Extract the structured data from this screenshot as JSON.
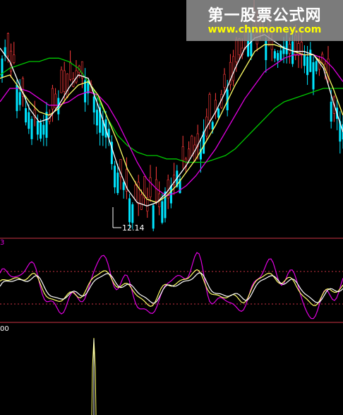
{
  "watermark": {
    "title": "第一股票公式网",
    "url": "www.chnmoney.com"
  },
  "colors": {
    "background": "#000000",
    "up": "#ff3b3b",
    "down": "#00e5ff",
    "ma_white": "#ffffff",
    "ma_yellow": "#ffff66",
    "ma_magenta": "#e000e0",
    "ma_green": "#00c800",
    "panel_line": "#cc3344"
  },
  "main_panel": {
    "low_marker_label": "12.14"
  },
  "indicator_panel": {
    "label": "3"
  },
  "volume_panel": {
    "label": "00"
  },
  "chart_data": {
    "type": "line",
    "series": [
      {
        "values": [
          17.2,
          16.8,
          16.1,
          15.4,
          15.0,
          15.1,
          15.5,
          16.0,
          16.4,
          16.3,
          15.5,
          14.6,
          13.7,
          13.0,
          12.6,
          12.5,
          12.6,
          12.9,
          13.3,
          13.7,
          14.2,
          14.8,
          15.3,
          15.9,
          16.6,
          17.2,
          17.5,
          17.6,
          17.4,
          17.2,
          17.1,
          17.1,
          17.0,
          16.6,
          15.6,
          14.7
        ]
      },
      {
        "values": [
          16.3,
          16.4,
          16.0,
          15.6,
          15.3,
          15.2,
          15.4,
          15.8,
          16.1,
          16.2,
          15.8,
          15.1,
          14.4,
          13.6,
          13.1,
          12.7,
          12.6,
          12.8,
          13.1,
          13.5,
          13.9,
          14.4,
          14.9,
          15.5,
          16.1,
          16.6,
          17.1,
          17.3,
          17.3,
          17.2,
          17.1,
          17.0,
          17.0,
          16.7,
          16.0,
          15.2
        ]
      },
      {
        "values": [
          15.6,
          16.0,
          16.0,
          15.9,
          15.7,
          15.5,
          15.5,
          15.6,
          15.8,
          15.9,
          15.8,
          15.5,
          15.0,
          14.4,
          13.8,
          13.3,
          13.0,
          12.8,
          12.9,
          13.1,
          13.4,
          13.8,
          14.2,
          14.7,
          15.2,
          15.7,
          16.1,
          16.5,
          16.7,
          16.9,
          17.0,
          17.0,
          17.0,
          16.9,
          16.6,
          16.2
        ]
      },
      {
        "values": [
          16.4,
          16.6,
          16.7,
          16.8,
          16.8,
          16.9,
          16.9,
          16.8,
          16.6,
          16.2,
          15.7,
          15.1,
          14.6,
          14.3,
          14.1,
          14.0,
          14.0,
          13.9,
          13.9,
          13.8,
          13.8,
          13.8,
          13.9,
          14.0,
          14.2,
          14.5,
          14.8,
          15.1,
          15.4,
          15.6,
          15.7,
          15.8,
          15.9,
          16.0,
          16.0,
          16.0
        ]
      }
    ],
    "annotations": [
      "12.14"
    ]
  }
}
